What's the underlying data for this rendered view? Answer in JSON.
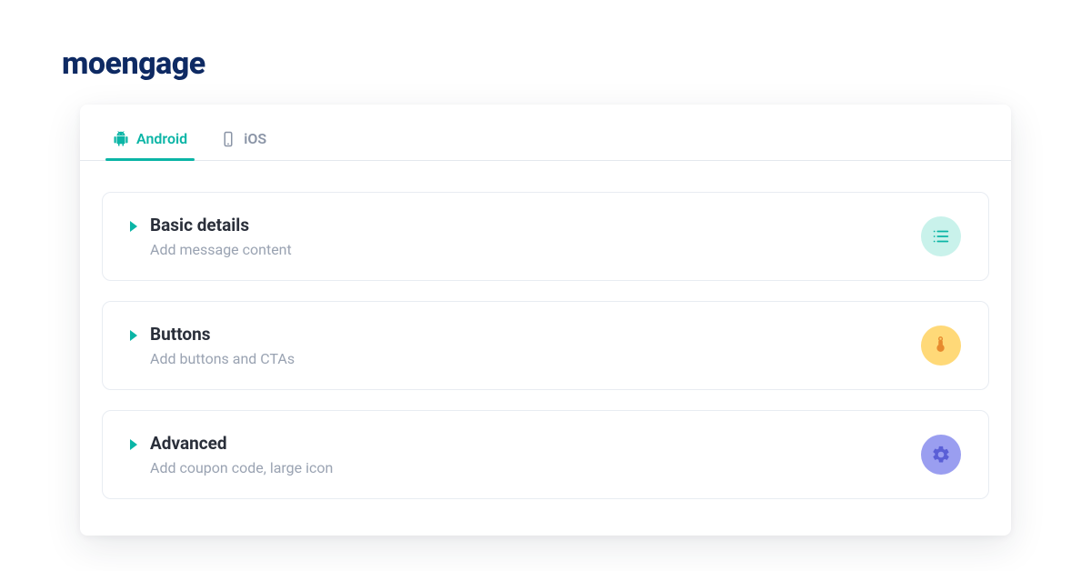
{
  "brand": {
    "name": "moengage"
  },
  "tabs": {
    "android": {
      "label": "Android",
      "active": true
    },
    "ios": {
      "label": "iOS",
      "active": false
    }
  },
  "sections": {
    "basic": {
      "title": "Basic details",
      "description": "Add message content",
      "icon": "list-icon",
      "badge_color": "teal"
    },
    "buttons": {
      "title": "Buttons",
      "description": "Add buttons and CTAs",
      "icon": "touch-icon",
      "badge_color": "yellow"
    },
    "advanced": {
      "title": "Advanced",
      "description": "Add coupon code, large icon",
      "icon": "gear-icon",
      "badge_color": "violet"
    }
  }
}
